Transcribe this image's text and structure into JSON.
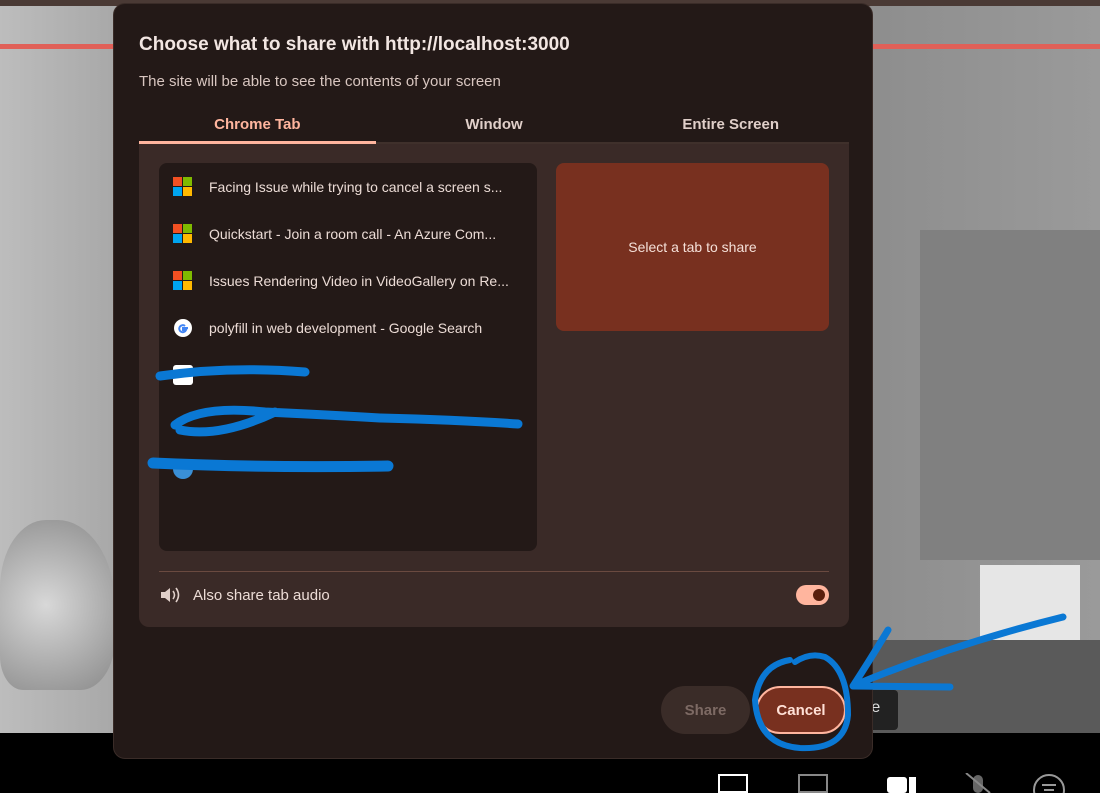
{
  "dialog": {
    "title": "Choose what to share with http://localhost:3000",
    "subtitle": "The site will be able to see the contents of your screen",
    "tabs": [
      {
        "label": "Chrome Tab",
        "active": true
      },
      {
        "label": "Window",
        "active": false
      },
      {
        "label": "Entire Screen",
        "active": false
      }
    ],
    "tab_list": [
      {
        "title": "Facing Issue while trying to cancel a screen s...",
        "icon": "microsoft-icon"
      },
      {
        "title": "Quickstart - Join a room call - An Azure Com...",
        "icon": "microsoft-icon"
      },
      {
        "title": "Issues Rendering Video in VideoGallery on Re...",
        "icon": "microsoft-icon"
      },
      {
        "title": "polyfill in web development - Google Search",
        "icon": "google-icon"
      },
      {
        "title": "",
        "icon": "redacted"
      },
      {
        "title": "",
        "icon": "redacted"
      },
      {
        "title": "",
        "icon": "redacted"
      }
    ],
    "preview_text": "Select a tab to share",
    "audio_label": "Also share tab audio",
    "audio_enabled": true,
    "share_label": "Share",
    "cancel_label": "Cancel"
  },
  "background": {
    "tooltip_fragment": "re"
  },
  "colors": {
    "accent": "#ffb59e",
    "dialog_bg": "#231917",
    "preview_bg": "#78301f",
    "annotation": "#0a78d4"
  }
}
